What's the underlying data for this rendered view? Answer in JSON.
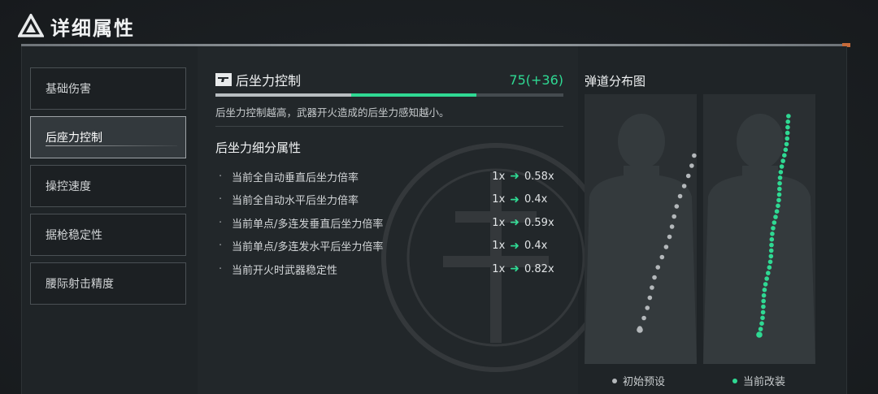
{
  "header": {
    "title": "详细属性"
  },
  "sidebar": {
    "items": [
      {
        "label": "基础伤害"
      },
      {
        "label": "后座力控制"
      },
      {
        "label": "操控速度"
      },
      {
        "label": "据枪稳定性"
      },
      {
        "label": "腰际射击精度"
      }
    ],
    "active_index": 1
  },
  "stat": {
    "name": "后坐力控制",
    "value_text": "75(+36)",
    "base": 39,
    "bonus": 36,
    "max": 100,
    "description": "后坐力控制越高，武器开火造成的后坐力感知越小。",
    "icon": "gun-icon"
  },
  "sub_section": {
    "title": "后坐力细分属性",
    "rows": [
      {
        "label": "当前全自动垂直后坐力倍率",
        "from": "1x",
        "to": "0.58x"
      },
      {
        "label": "当前全自动水平后坐力倍率",
        "from": "1x",
        "to": "0.4x"
      },
      {
        "label": "当前单点/多连发垂直后坐力倍率",
        "from": "1x",
        "to": "0.59x"
      },
      {
        "label": "当前单点/多连发水平后坐力倍率",
        "from": "1x",
        "to": "0.4x"
      },
      {
        "label": "当前开火时武器稳定性",
        "from": "1x",
        "to": "0.82x"
      }
    ],
    "arrow_icon": "right-arrow-icon"
  },
  "spread_chart": {
    "title": "弹道分布图",
    "legend": [
      {
        "label": "初始预设",
        "color": "#b4b8bb"
      },
      {
        "label": "当前改装",
        "color": "#2fd993"
      }
    ]
  },
  "colors": {
    "accent": "#2fd993",
    "bar_base": "#b9bec1"
  }
}
